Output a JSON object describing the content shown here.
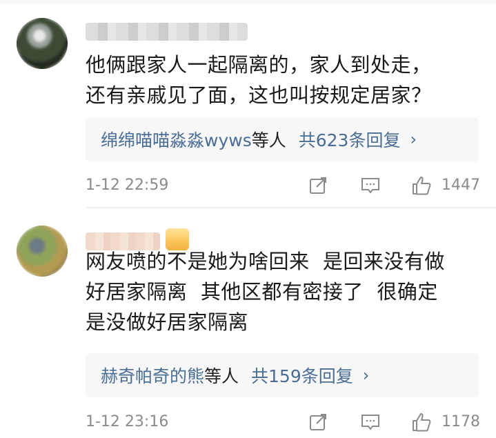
{
  "comments": [
    {
      "text": "他俩跟家人一起隔离的，家人到处走，\n还有亲戚见了面，这也叫按规定居家？",
      "replies": {
        "names": "绵绵喵喵淼淼wyws",
        "suffix": "等人",
        "count": "共623条回复",
        "chevron": "›"
      },
      "time": "1-12 22:59",
      "likes": "1447"
    },
    {
      "text": "网友喷的不是她为啥回来  是回来没有做\n好居家隔离  其他区都有密接了  很确定\n是没做好居家隔离",
      "replies": {
        "names": "赫奇帕奇的熊",
        "suffix": "等人",
        "count": "共159条回复",
        "chevron": "›"
      },
      "time": "1-12 23:16",
      "likes": "1178"
    }
  ],
  "icons": {
    "share": "share-icon",
    "comment": "comment-icon",
    "like": "thumbs-up-icon"
  },
  "colors": {
    "link": "#4a6d96",
    "muted": "#8a8a8a",
    "reply_bg": "#f7f7f7"
  }
}
